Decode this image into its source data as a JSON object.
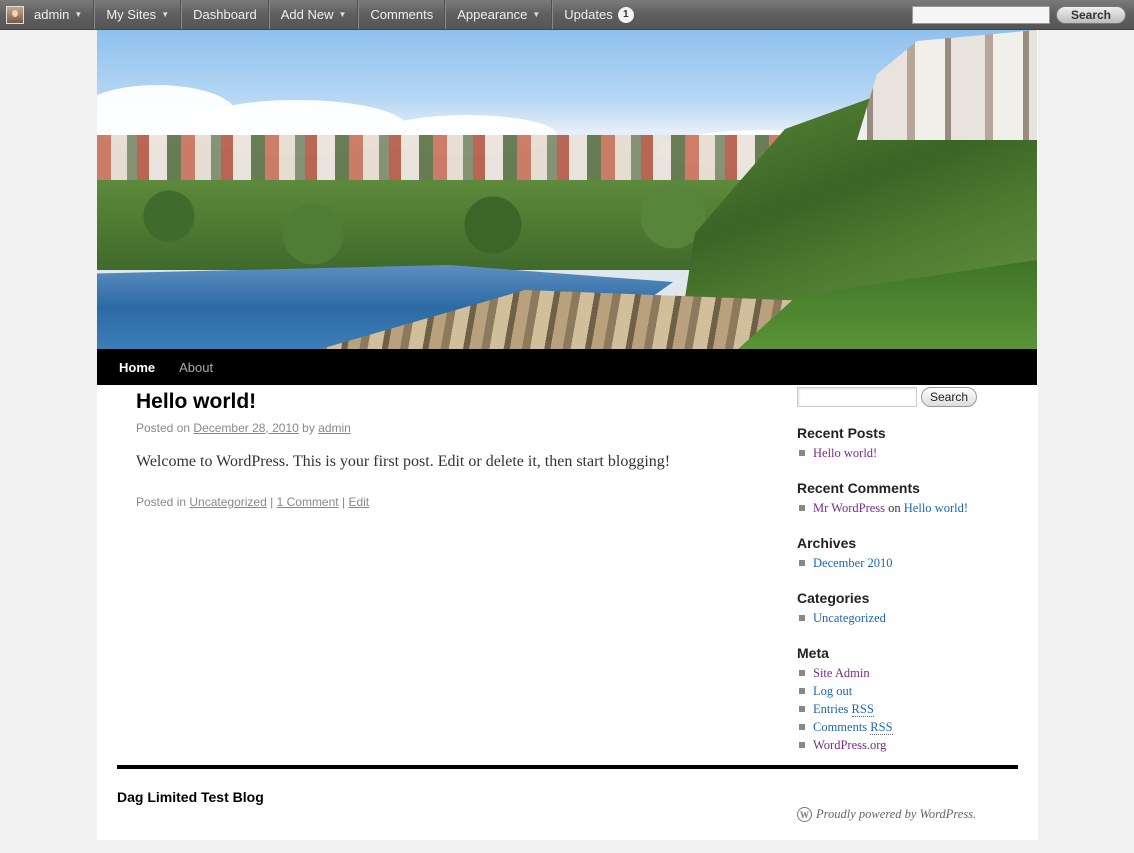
{
  "admin_bar": {
    "user": "admin",
    "items": [
      {
        "label": "My Sites",
        "has_menu": true
      },
      {
        "label": "Dashboard",
        "has_menu": false
      },
      {
        "label": "Add New",
        "has_menu": true
      },
      {
        "label": "Comments",
        "has_menu": false
      },
      {
        "label": "Appearance",
        "has_menu": true
      },
      {
        "label": "Updates",
        "has_menu": false
      }
    ],
    "updates_count": "1",
    "search_button": "Search",
    "search_value": ""
  },
  "nav": {
    "home": "Home",
    "about": "About"
  },
  "post": {
    "title": "Hello world!",
    "posted_on": "Posted on",
    "date": "December 28, 2010",
    "by": "by",
    "author": "admin",
    "content": "Welcome to WordPress. This is your first post. Edit or delete it, then start blogging!",
    "posted_in": "Posted in",
    "category": "Uncategorized",
    "sep": "|",
    "comments": "1 Comment",
    "edit": "Edit"
  },
  "sidebar": {
    "search_button": "Search",
    "search_value": "",
    "recent_posts": {
      "title": "Recent Posts",
      "items": [
        "Hello world!"
      ]
    },
    "recent_comments": {
      "title": "Recent Comments",
      "author": "Mr WordPress",
      "on": "on",
      "post": "Hello world!"
    },
    "archives": {
      "title": "Archives",
      "items": [
        "December 2010"
      ]
    },
    "categories": {
      "title": "Categories",
      "items": [
        "Uncategorized"
      ]
    },
    "meta": {
      "title": "Meta",
      "site_admin": "Site Admin",
      "log_out": "Log out",
      "entries": "Entries",
      "comments": "Comments",
      "rss": "RSS",
      "wordpress_org": "WordPress.org"
    }
  },
  "footer": {
    "site_title": "Dag Limited Test Blog",
    "powered": "Proudly powered by WordPress."
  }
}
